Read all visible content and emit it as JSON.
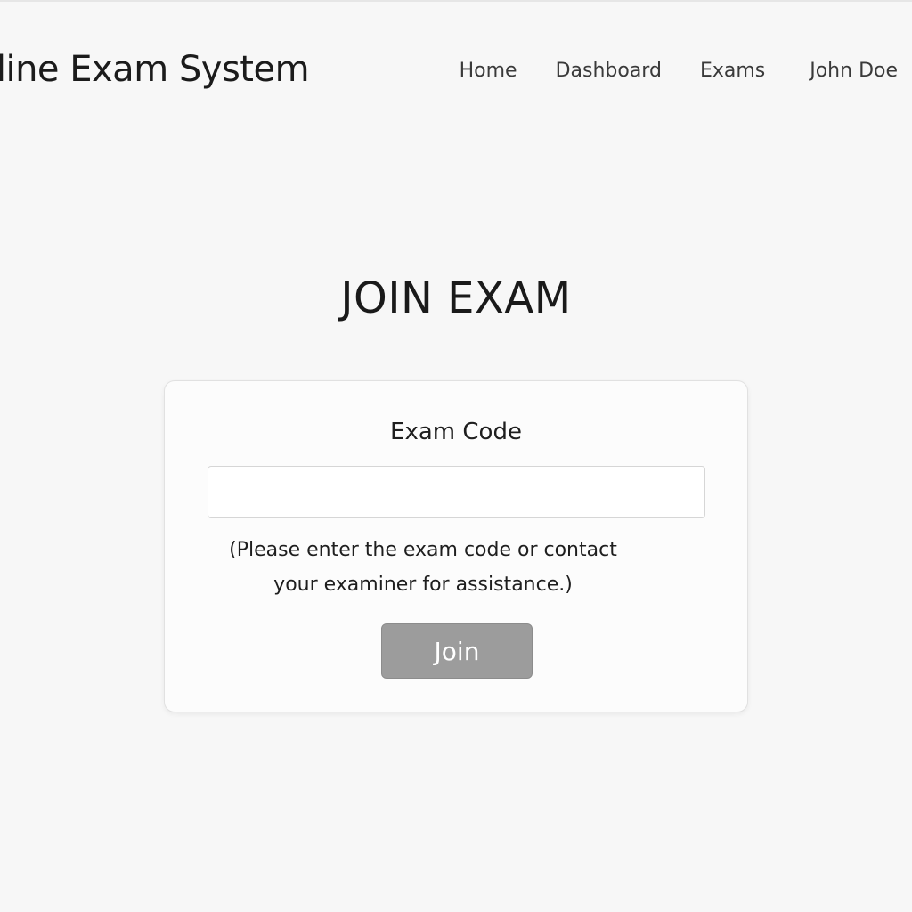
{
  "header": {
    "app_title": "Online Exam System",
    "nav": {
      "home": "Home",
      "dashboard": "Dashboard",
      "exams": "Exams",
      "user": "John Doe"
    }
  },
  "main": {
    "heading": "JOIN EXAM",
    "form": {
      "label": "Exam Code",
      "input_value": "",
      "input_placeholder": "",
      "help_line1": "(Please enter the exam code or contact",
      "help_line2": "your examiner for assistance.)",
      "join_label": "Join"
    }
  },
  "colors": {
    "background": "#f7f7f7",
    "card": "#fcfcfc",
    "button_disabled": "#9c9c9c",
    "text": "#1e1e1e"
  }
}
